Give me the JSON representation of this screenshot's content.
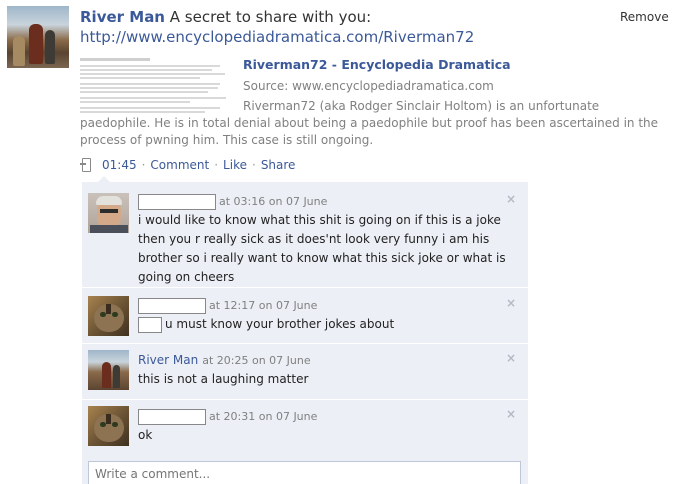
{
  "post": {
    "poster_name": "River Man",
    "message": "A secret to share with you:",
    "link_url": "http://www.encyclopediadramatica.com/Riverman72",
    "remove_label": "Remove",
    "attachment": {
      "title": "Riverman72 - Encyclopedia Dramatica",
      "source": "Source: www.encyclopediadramatica.com",
      "description_first": "Riverman72 (aka Rodger Sinclair Holtom) is an unfortunate",
      "description_rest": "paedophile. He is in total denial about being a paedophile but proof has been ascertained in the process of pwning him. This case is still ongoing."
    },
    "actions": {
      "time": "01:45",
      "comment_label": "Comment",
      "like_label": "Like",
      "share_label": "Share",
      "separator": "·"
    }
  },
  "comments": [
    {
      "author": "",
      "time": "at 03:16 on 07 June",
      "text": "i would like to know what this shit is going on if this is a joke then you r really sick as it does'nt look very funny i am his brother so i really want to know what this sick joke or what is going on cheers",
      "avatar": "old-man-avatar"
    },
    {
      "author": "",
      "time": "at 12:17 on 07 June",
      "text": "u must know your brother jokes about",
      "avatar": "cat-avatar"
    },
    {
      "author": "River Man",
      "time": "at 20:25 on 07 June",
      "text": "this is not a laughing matter",
      "avatar": "river-man-avatar"
    },
    {
      "author": "",
      "time": "at 20:31 on 07 June",
      "text": "ok",
      "avatar": "cat-avatar"
    }
  ],
  "comment_input": {
    "placeholder": "Write a comment..."
  },
  "icons": {
    "close": "×",
    "mobile": "mobile-upload-icon"
  },
  "colors": {
    "link": "#3b5998",
    "comments_bg": "#eceff5",
    "muted": "#808080"
  }
}
